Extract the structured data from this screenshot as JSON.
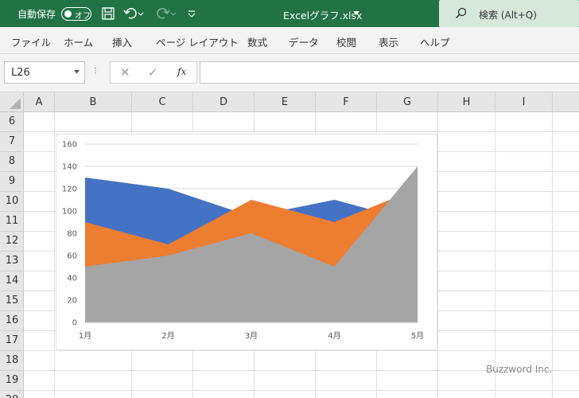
{
  "titlebar": {
    "autosave_label": "自動保存",
    "autosave_state": "オフ",
    "filename": "Excelグラフ.xlsx",
    "search_label": "検索 (Alt+Q)"
  },
  "menu": {
    "tabs": [
      "ファイル",
      "ホーム",
      "挿入",
      "ページ レイアウト",
      "数式",
      "データ",
      "校閲",
      "表示",
      "ヘルプ"
    ]
  },
  "formula_bar": {
    "name_box": "L26",
    "fx_label": "fx",
    "value": ""
  },
  "grid": {
    "columns": [
      "A",
      "B",
      "C",
      "D",
      "E",
      "F",
      "G",
      "H",
      "I"
    ],
    "rows": [
      "6",
      "7",
      "8",
      "9",
      "10",
      "11",
      "12",
      "13",
      "14",
      "15",
      "16",
      "17",
      "18",
      "19",
      "20"
    ]
  },
  "chart_data": {
    "type": "area",
    "categories": [
      "1月",
      "2月",
      "3月",
      "4月",
      "5月"
    ],
    "series": [
      {
        "values": [
          130,
          120,
          95,
          110,
          90
        ],
        "color": "#4472c4"
      },
      {
        "values": [
          90,
          70,
          110,
          90,
          120
        ],
        "color": "#ed7d31"
      },
      {
        "values": [
          50,
          60,
          80,
          50,
          140
        ],
        "color": "#a5a5a5"
      }
    ],
    "ylim": [
      0,
      160
    ],
    "yticks": [
      0,
      20,
      40,
      60,
      80,
      100,
      120,
      140,
      160
    ],
    "grid": true,
    "legend": "none"
  },
  "watermark": "Buzzword Inc.",
  "colors": {
    "titlebar": "#217346",
    "accent": "#217346"
  }
}
